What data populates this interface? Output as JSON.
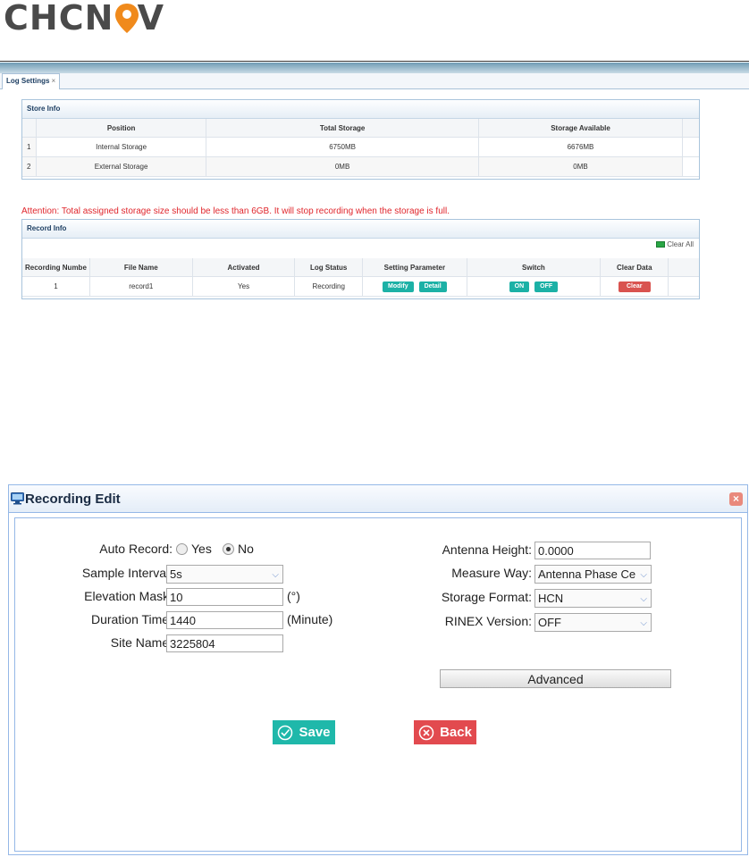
{
  "brand": {
    "logo_text_1": "CHCN",
    "logo_text_2": "V"
  },
  "tabs": [
    {
      "label": "Log Settings",
      "close": "×"
    }
  ],
  "store_info": {
    "title": "Store Info",
    "columns": [
      "",
      "Position",
      "Total Storage",
      "Storage Available"
    ],
    "rows": [
      {
        "idx": "1",
        "position": "Internal Storage",
        "total": "6750MB",
        "available": "6676MB"
      },
      {
        "idx": "2",
        "position": "External Storage",
        "total": "0MB",
        "available": "0MB"
      }
    ]
  },
  "attention": "Attention: Total assigned storage size should be less than 6GB. It will stop recording when the storage is full.",
  "record_info": {
    "title": "Record Info",
    "clear_all": "Clear All",
    "columns": [
      "Recording Numbe",
      "File Name",
      "Activated",
      "Log Status",
      "Setting Parameter",
      "Switch",
      "Clear Data"
    ],
    "rows": [
      {
        "number": "1",
        "file": "record1",
        "activated": "Yes",
        "status": "Recording",
        "modify": "Modify",
        "detail": "Detail",
        "on": "ON",
        "off": "OFF",
        "clear": "Clear"
      }
    ]
  },
  "dialog": {
    "title": "Recording Edit",
    "close": "×",
    "auto_record_label": "Auto Record:",
    "auto_record_yes": "Yes",
    "auto_record_no": "No",
    "auto_record_value": "No",
    "sample_interval_label": "Sample Interval:",
    "sample_interval_value": "5s",
    "elevation_mask_label": "Elevation Mask:",
    "elevation_mask_value": "10",
    "elevation_mask_unit": "(°)",
    "duration_time_label": "Duration Time:",
    "duration_time_value": "1440",
    "duration_time_unit": "(Minute)",
    "site_name_label": "Site Name:",
    "site_name_value": "3225804",
    "antenna_height_label": "Antenna Height:",
    "antenna_height_value": "0.0000",
    "measure_way_label": "Measure Way:",
    "measure_way_value": "Antenna Phase Ce",
    "storage_format_label": "Storage Format:",
    "storage_format_value": "HCN",
    "rinex_version_label": "RINEX Version:",
    "rinex_version_value": "OFF",
    "advanced_label": "Advanced",
    "save_label": "Save",
    "back_label": "Back"
  },
  "colors": {
    "teal": "#1cb1a6",
    "red": "#d9534f",
    "attention": "#e0262c",
    "logo_orange": "#f08a1c"
  }
}
